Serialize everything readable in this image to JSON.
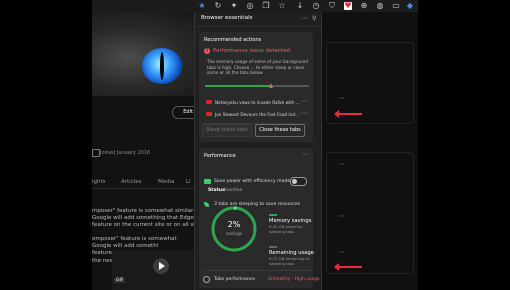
{
  "colors": {
    "accent_red": "#f05a6a",
    "accent_green": "#2da44e",
    "panel_bg": "#202020",
    "card_bg": "#2a2a2a",
    "annotation_arrow": "#e0303a"
  },
  "toolbar": {
    "icons": [
      "star-icon",
      "refresh-icon",
      "extensions-icon",
      "copilot-icon",
      "collections-icon",
      "favorites-icon",
      "downloads-icon",
      "history-icon",
      "shield-icon",
      "health-icon",
      "browser-essentials-icon",
      "profile-icon",
      "tab-icon",
      "settings-icon"
    ]
  },
  "page_behind": {
    "edit_button": "Edit pro",
    "joined_text": "Joined January 2016",
    "tabs": [
      "ights",
      "Articles",
      "Media",
      "Li"
    ],
    "article_lines": [
      "mposer\" feature is somewhat similar to the nu",
      "Google will add something that Edge's nudge,",
      "feature on the current site or on all sites direc",
      "",
      "omposer\" feature is somewhat",
      "Google will add somethi",
      "feature on the current site or"
    ],
    "article_tail": "the new \"",
    "gif_label": "GIF"
  },
  "panel": {
    "title": "Browser essentials",
    "recommended": {
      "heading": "Recommended actions",
      "issue_title": "Performance issue detected",
      "issue_desc": "The memory usage of some of your background tabs is high. Choose ... to either sleep or close some or all the tabs below.",
      "slider_level": 0.64,
      "tabs": [
        {
          "label": "Netanyahu vows to invade Rafah with ..."
        },
        {
          "label": "Jon Stewart Devours the Fast Food Ind..."
        }
      ],
      "sleep_button": "Sleep these tabs",
      "close_button": "Close these tabs"
    },
    "performance": {
      "heading": "Performance",
      "efficiency_label": "Save power with efficiency mode",
      "status_label": "Status",
      "status_value": "Inactive",
      "sleeping_label": "3 tabs are sleeping to save resources",
      "savings_pct": "2%",
      "savings_label": "savings",
      "ring_fraction": 0.02,
      "memory_savings_title": "Memory savings",
      "memory_savings_desc": "0.05 GB saved by sleeping tabs",
      "remaining_title": "Remaining usage",
      "remaining_desc": "0.72 GB remaining in sleeping tabs",
      "tabs_perf_label": "Tabs performance",
      "tabs_perf_status": "Unhealthy - High usage"
    }
  }
}
